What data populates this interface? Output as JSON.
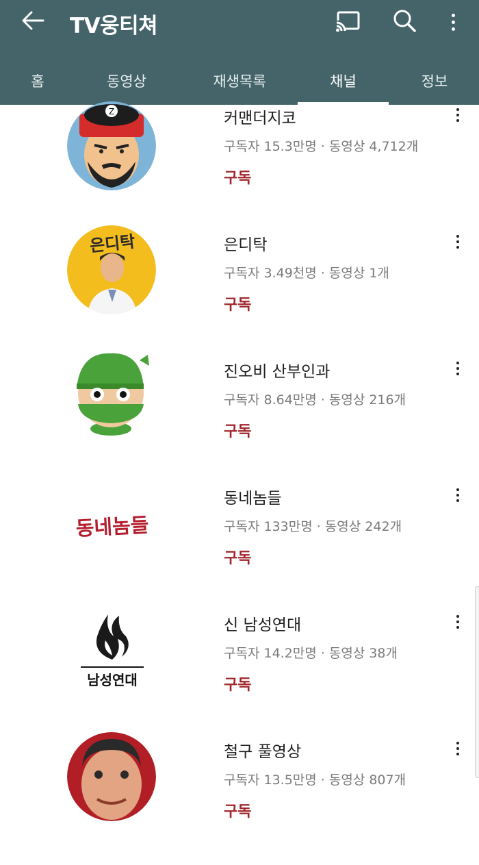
{
  "app": {
    "title": "TV웅티쳐",
    "colors": {
      "header": "#45646a",
      "subscribe": "#a0272c"
    },
    "icons": [
      "back-arrow-icon",
      "cast-icon",
      "search-icon",
      "more-vert-icon"
    ]
  },
  "tabs": [
    {
      "label": "홈",
      "active": false
    },
    {
      "label": "동영상",
      "active": false
    },
    {
      "label": "재생목록",
      "active": false
    },
    {
      "label": "채널",
      "active": true
    },
    {
      "label": "정보",
      "active": false
    }
  ],
  "channels": [
    {
      "name": "커맨더지코",
      "meta": "구독자 15.3만명 · 동영상 4,712개",
      "subscribe": "구독"
    },
    {
      "name": "은디탁",
      "meta": "구독자 3.49천명 · 동영상 1개",
      "subscribe": "구독",
      "logo_text": "은디탁"
    },
    {
      "name": "진오비 산부인과",
      "meta": "구독자 8.64만명 · 동영상 216개",
      "subscribe": "구독"
    },
    {
      "name": "동네놈들",
      "meta": "구독자 133만명 · 동영상 242개",
      "subscribe": "구독",
      "logo_text": "동네놈들"
    },
    {
      "name": "신 남성연대",
      "meta": "구독자 14.2만명 · 동영상 38개",
      "subscribe": "구독",
      "logo_text": "남성연대"
    },
    {
      "name": "철구 풀영상",
      "meta": "구독자 13.5만명 · 동영상 807개",
      "subscribe": "구독"
    }
  ]
}
